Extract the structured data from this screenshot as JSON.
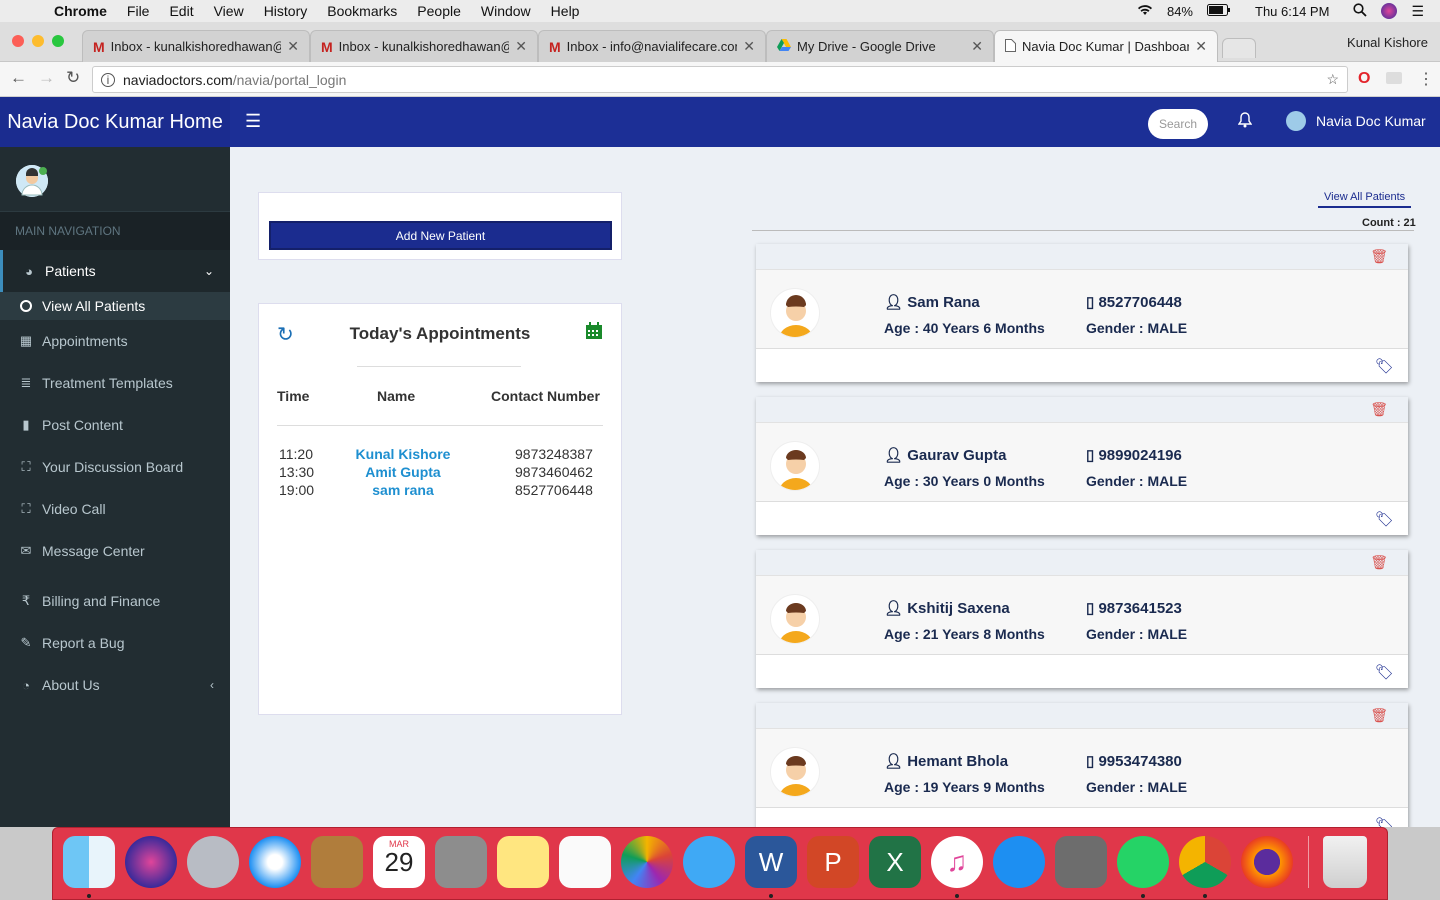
{
  "menubar": {
    "app": "Chrome",
    "items": [
      "File",
      "Edit",
      "View",
      "History",
      "Bookmarks",
      "People",
      "Window",
      "Help"
    ],
    "battery": "84%",
    "clock": "Thu 6:14 PM"
  },
  "tabs": [
    {
      "label": "Inbox - kunalkishoredhawan@",
      "icon": "gmail-icon"
    },
    {
      "label": "Inbox - kunalkishoredhawan@",
      "icon": "gmail-icon"
    },
    {
      "label": "Inbox - info@navialifecare.com",
      "icon": "gmail-icon"
    },
    {
      "label": "My Drive - Google Drive",
      "icon": "drive-icon"
    },
    {
      "label": "Navia Doc Kumar | Dashboard",
      "icon": "page-icon"
    }
  ],
  "profile": "Kunal Kishore",
  "url": {
    "host": "naviadoctors.com",
    "path": "/navia/portal_login"
  },
  "header": {
    "brand": "Navia Doc Kumar Home",
    "search_placeholder": "Search",
    "user": "Navia Doc Kumar"
  },
  "sidebar": {
    "heading": "MAIN NAVIGATION",
    "items": [
      {
        "label": "Patients",
        "icon": "dashboard-icon"
      },
      {
        "label": "View All Patients",
        "icon": "circle-icon"
      },
      {
        "label": "Appointments",
        "icon": "calendar-icon"
      },
      {
        "label": "Treatment Templates",
        "icon": "list-icon"
      },
      {
        "label": "Post Content",
        "icon": "file-icon"
      },
      {
        "label": "Your Discussion Board",
        "icon": "sitemap-icon"
      },
      {
        "label": "Video Call",
        "icon": "sitemap-icon"
      },
      {
        "label": "Message Center",
        "icon": "envelope-icon"
      },
      {
        "label": "Billing and Finance",
        "icon": "rupee-icon"
      },
      {
        "label": "Report a Bug",
        "icon": "pencil-icon"
      },
      {
        "label": "About Us",
        "icon": "pie-chart-icon"
      }
    ]
  },
  "main": {
    "add_patient": "Add New Patient",
    "appointments": {
      "title": "Today's Appointments",
      "headers": [
        "Time",
        "Name",
        "Contact Number"
      ],
      "rows": [
        {
          "time": "11:20",
          "name": "Kunal Kishore",
          "contact": "9873248387"
        },
        {
          "time": "13:30",
          "name": "Amit Gupta",
          "contact": "9873460462"
        },
        {
          "time": "19:00",
          "name": "sam rana",
          "contact": "8527706448"
        }
      ]
    },
    "view_all": "View All Patients",
    "count": "Count : 21",
    "patients": [
      {
        "name": "Sam Rana",
        "phone": "8527706448",
        "age": "Age : 40 Years 6 Months",
        "gender": "Gender : MALE"
      },
      {
        "name": "Gaurav Gupta",
        "phone": "9899024196",
        "age": "Age : 30 Years 0 Months",
        "gender": "Gender : MALE"
      },
      {
        "name": "Kshitij Saxena",
        "phone": "9873641523",
        "age": "Age : 21 Years 8 Months",
        "gender": "Gender : MALE"
      },
      {
        "name": "Hemant Bhola",
        "phone": "9953474380",
        "age": "Age : 19 Years 9 Months",
        "gender": "Gender : MALE"
      }
    ]
  },
  "dock": {
    "calendar_month": "MAR",
    "calendar_day": "29"
  },
  "colors": {
    "header": "#1c2f96",
    "sidebar": "#222d32",
    "accent": "#1e8fd0",
    "delete": "#d9534f"
  }
}
